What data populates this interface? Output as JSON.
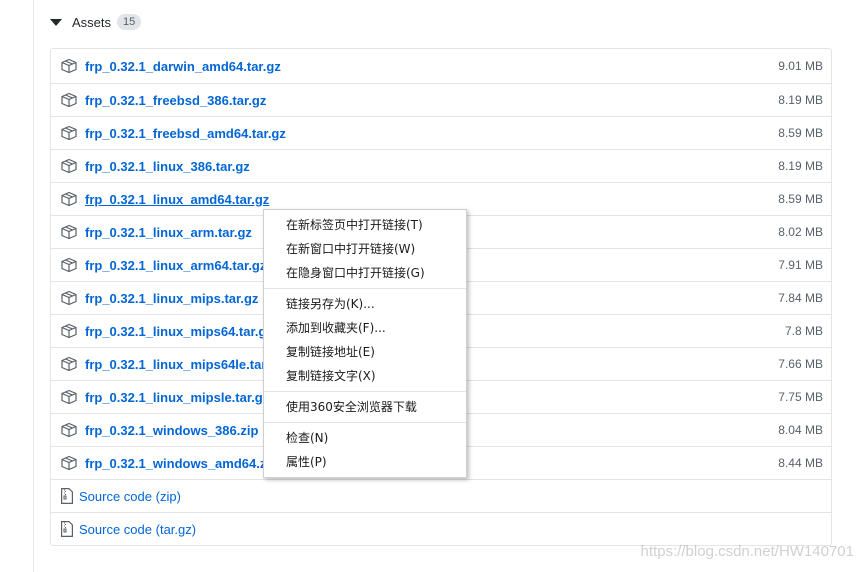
{
  "assets": {
    "title": "Assets",
    "count": "15",
    "files": [
      {
        "name": "frp_0.32.1_darwin_amd64.tar.gz",
        "size": "9.01 MB"
      },
      {
        "name": "frp_0.32.1_freebsd_386.tar.gz",
        "size": "8.19 MB"
      },
      {
        "name": "frp_0.32.1_freebsd_amd64.tar.gz",
        "size": "8.59 MB"
      },
      {
        "name": "frp_0.32.1_linux_386.tar.gz",
        "size": "8.19 MB"
      },
      {
        "name": "frp_0.32.1_linux_amd64.tar.gz",
        "size": "8.59 MB"
      },
      {
        "name": "frp_0.32.1_linux_arm.tar.gz",
        "size": "8.02 MB"
      },
      {
        "name": "frp_0.32.1_linux_arm64.tar.gz",
        "size": "7.91 MB"
      },
      {
        "name": "frp_0.32.1_linux_mips.tar.gz",
        "size": "7.84 MB"
      },
      {
        "name": "frp_0.32.1_linux_mips64.tar.gz",
        "size": "7.8 MB"
      },
      {
        "name": "frp_0.32.1_linux_mips64le.tar.gz",
        "size": "7.66 MB"
      },
      {
        "name": "frp_0.32.1_linux_mipsle.tar.gz",
        "size": "7.75 MB"
      },
      {
        "name": "frp_0.32.1_windows_386.zip",
        "size": "8.04 MB"
      },
      {
        "name": "frp_0.32.1_windows_amd64.zip",
        "size": "8.44 MB"
      }
    ],
    "source": [
      {
        "label": "Source code",
        "format": "(zip)"
      },
      {
        "label": "Source code",
        "format": "(tar.gz)"
      }
    ]
  },
  "context_menu": {
    "group1": [
      "在新标签页中打开链接(T)",
      "在新窗口中打开链接(W)",
      "在隐身窗口中打开链接(G)"
    ],
    "group2": [
      "链接另存为(K)...",
      "添加到收藏夹(F)...",
      "复制链接地址(E)",
      "复制链接文字(X)"
    ],
    "group3": [
      "使用360安全浏览器下载"
    ],
    "group4": [
      "检查(N)",
      "属性(P)"
    ]
  },
  "watermark": "https://blog.csdn.net/HW140701",
  "colors": {
    "link": "#0366d6",
    "border": "#e1e4e8",
    "muted": "#586069"
  }
}
